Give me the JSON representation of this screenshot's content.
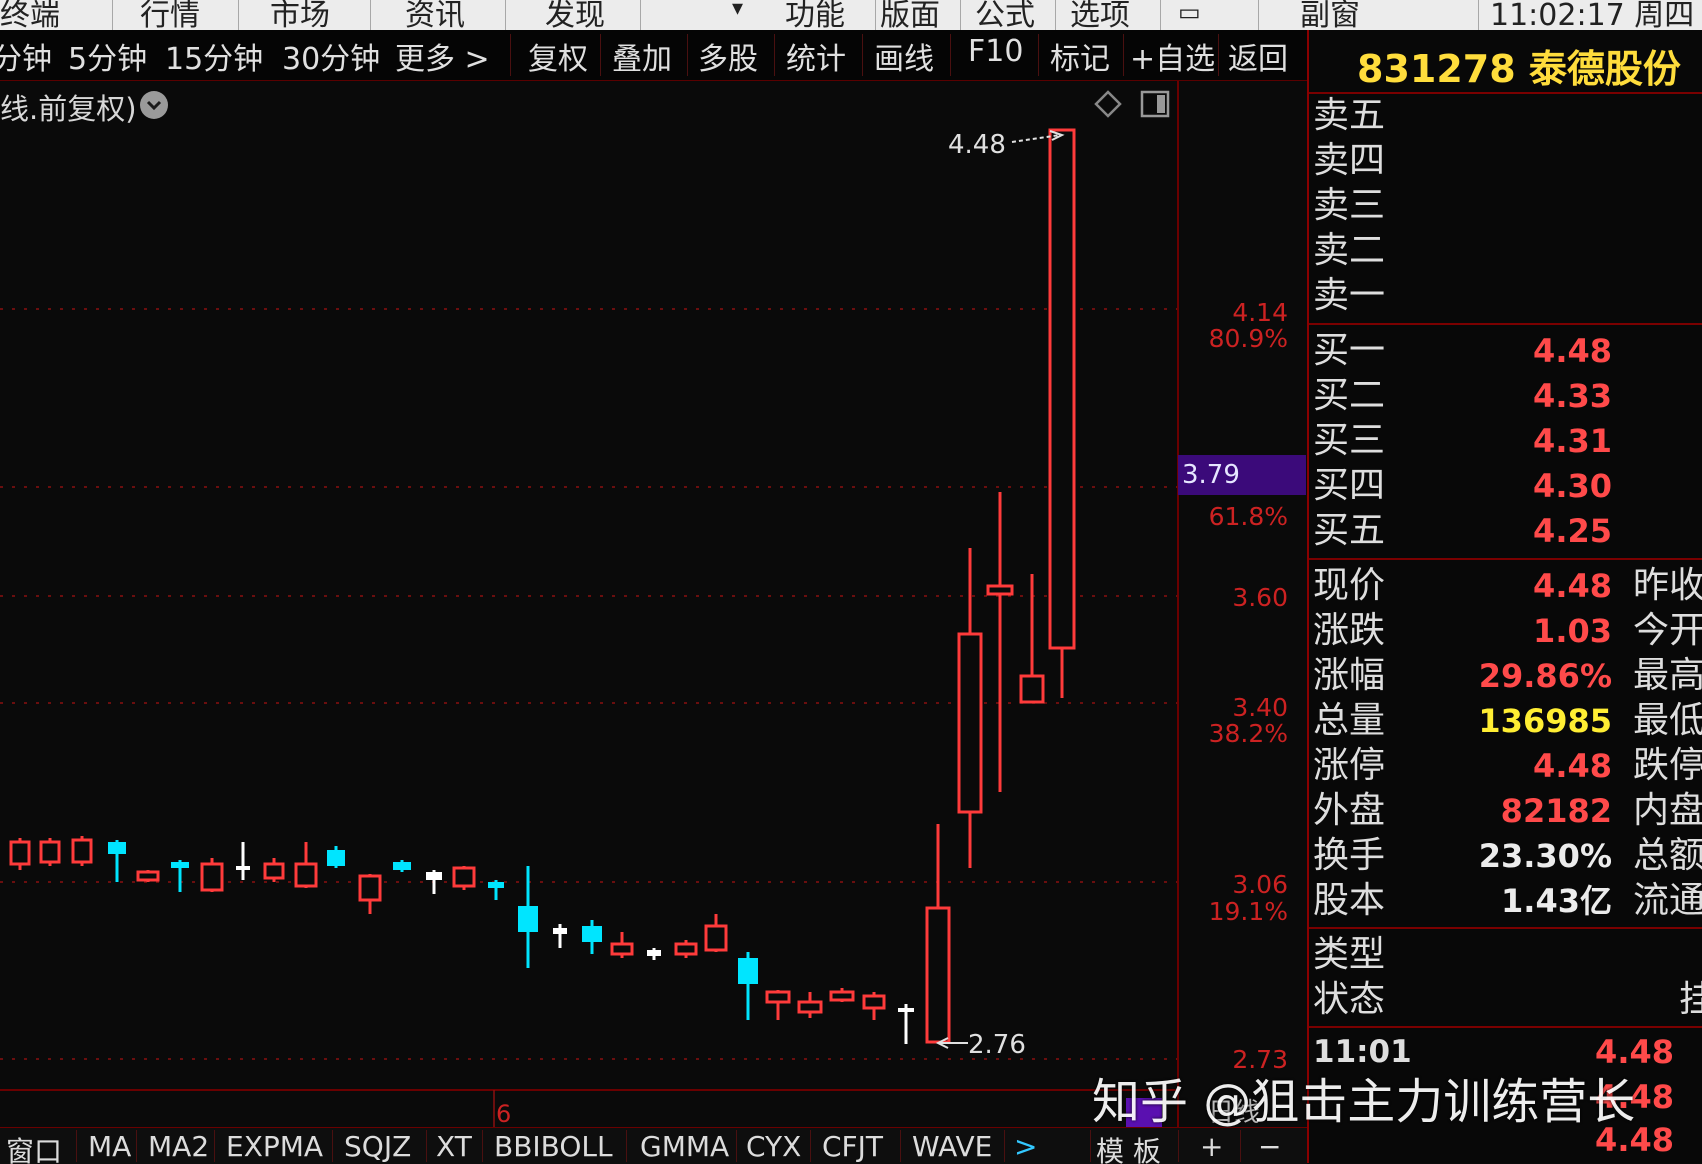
{
  "top_menu": [
    "终端",
    "行情",
    "市场",
    "资讯",
    "发现",
    "功能",
    "版面",
    "公式",
    "选项",
    "副窗",
    "11:02:17 周四"
  ],
  "toolbar": {
    "items": [
      "分钟",
      "5分钟",
      "15分钟",
      "30分钟",
      "更多 >",
      "复权",
      "叠加",
      "多股",
      "统计",
      "画线",
      "F10",
      "标记",
      "+自选",
      "返回"
    ]
  },
  "chart": {
    "subtitle": "线.前复权)",
    "dropdown_icon": "chevron-down-icon",
    "price_axis": [
      {
        "price": "4.14",
        "pct": "80.9%"
      },
      {
        "price": "",
        "pct": "61.8%"
      },
      {
        "price": "3.60",
        "pct": ""
      },
      {
        "price": "3.40",
        "pct": "38.2%"
      },
      {
        "price": "3.06",
        "pct": "19.1%"
      },
      {
        "price": "2.73",
        "pct": ""
      }
    ],
    "current_price_tag": "3.79",
    "high_marker": "4.48",
    "low_marker": "2.76",
    "date_label": "6",
    "mode_label": "日线",
    "colors": {
      "up": "#ff3b3b",
      "down": "#00e5ff",
      "doji": "#ffffff",
      "grid": "#8a1010",
      "price_tag_bg": "#3b0a7a"
    }
  },
  "quote_panel": {
    "title": "831278 泰德股份",
    "sell": [
      {
        "label": "卖五",
        "value": ""
      },
      {
        "label": "卖四",
        "value": ""
      },
      {
        "label": "卖三",
        "value": ""
      },
      {
        "label": "卖二",
        "value": ""
      },
      {
        "label": "卖一",
        "value": ""
      }
    ],
    "buy": [
      {
        "label": "买一",
        "value": "4.48"
      },
      {
        "label": "买二",
        "value": "4.33"
      },
      {
        "label": "买三",
        "value": "4.31"
      },
      {
        "label": "买四",
        "value": "4.30"
      },
      {
        "label": "买五",
        "value": "4.25"
      }
    ],
    "stats": [
      {
        "label": "现价",
        "value": "4.48",
        "side": "昨收",
        "color": "red"
      },
      {
        "label": "涨跌",
        "value": "1.03",
        "side": "今开",
        "color": "red"
      },
      {
        "label": "涨幅",
        "value": "29.86%",
        "side": "最高",
        "color": "red"
      },
      {
        "label": "总量",
        "value": "136985",
        "side": "最低",
        "color": "yellow"
      },
      {
        "label": "涨停",
        "value": "4.48",
        "side": "跌停",
        "color": "red"
      },
      {
        "label": "外盘",
        "value": "82182",
        "side": "内盘",
        "color": "red"
      },
      {
        "label": "换手",
        "value": "23.30%",
        "side": "总额",
        "color": "white"
      },
      {
        "label": "股本",
        "value": "1.43亿",
        "side": "流通",
        "color": "white"
      }
    ],
    "type_label": "类型",
    "status_label": "状态",
    "status_side": "挂",
    "ticks": [
      {
        "time": "11:01",
        "price": "4.48"
      },
      {
        "time": "",
        "price": "4.48"
      },
      {
        "time": "",
        "price": "4.48"
      }
    ]
  },
  "bottom_tabs": [
    "窗口",
    "MA",
    "MA2",
    "EXPMA",
    "SQJZ",
    "XT",
    "BBIBOLL",
    "GMMA",
    "CYX",
    "CFJT",
    "WAVE",
    ">",
    "模 板",
    "+",
    "−"
  ],
  "watermark": "知乎 @狙击主力训练营长"
}
